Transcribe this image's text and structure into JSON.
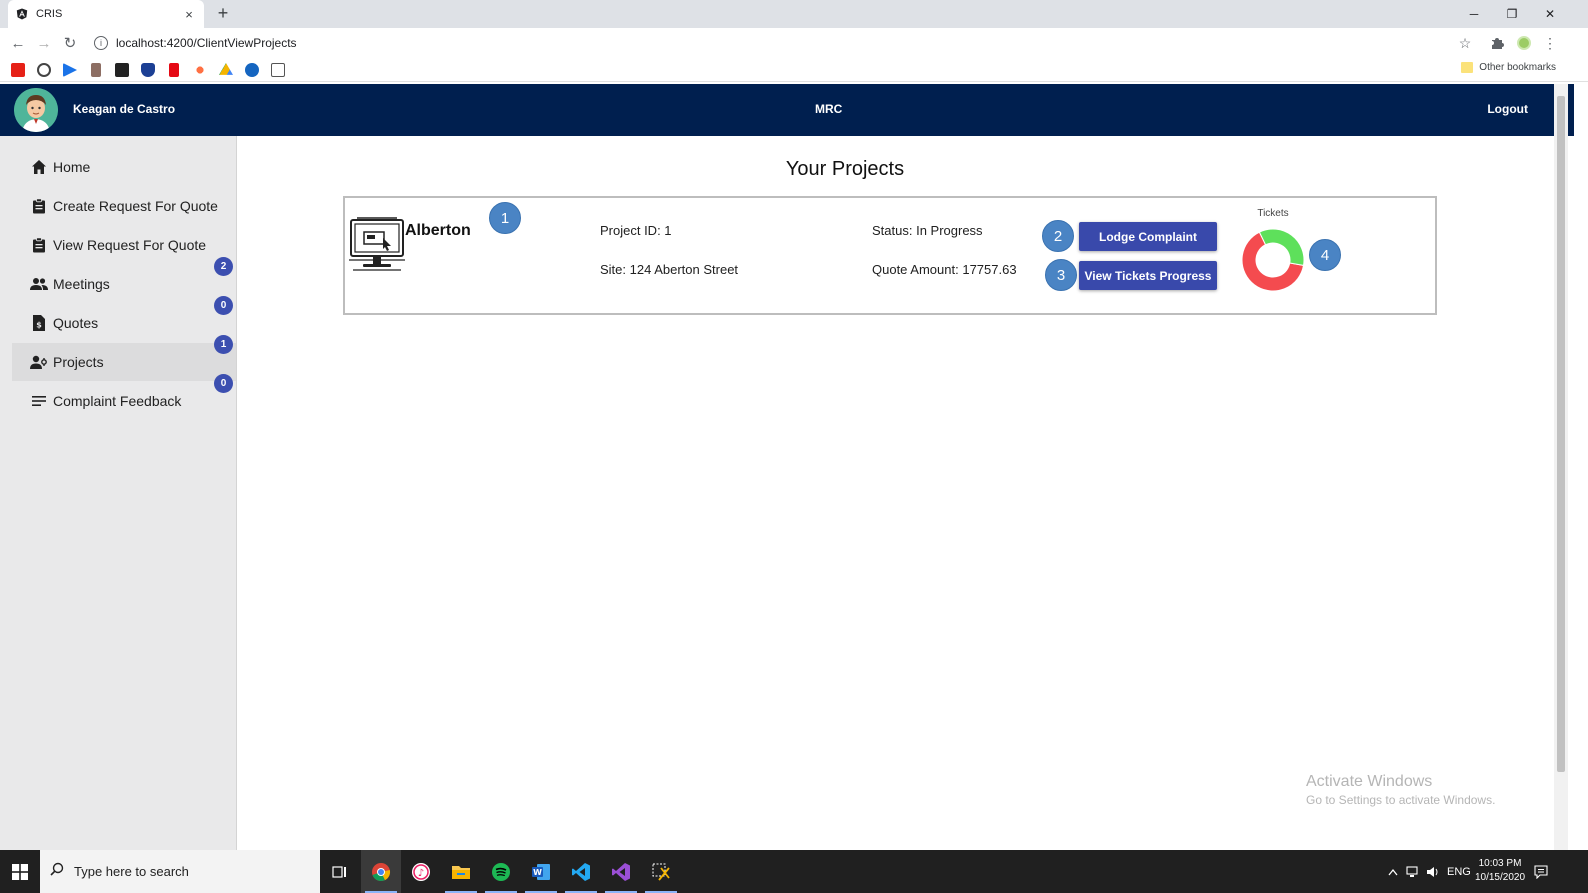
{
  "browser": {
    "tab_title": "CRIS",
    "tab_close": "×",
    "new_tab": "+",
    "url": "localhost:4200/ClientViewProjects",
    "other_bookmarks": "Other bookmarks",
    "window_controls": {
      "minimize": "─",
      "restore": "❐",
      "close": "✕"
    }
  },
  "header": {
    "user_name": "Keagan de Castro",
    "brand": "MRC",
    "logout": "Logout"
  },
  "sidebar": {
    "items": [
      {
        "label": "Home",
        "icon": "home-icon"
      },
      {
        "label": "Create Request For Quote",
        "icon": "clipboard-icon"
      },
      {
        "label": "View Request For Quote",
        "icon": "clipboard-icon"
      },
      {
        "label": "Meetings",
        "icon": "people-icon"
      },
      {
        "label": "Quotes",
        "icon": "invoice-icon"
      },
      {
        "label": "Projects",
        "icon": "person-manage-icon"
      },
      {
        "label": "Complaint Feedback",
        "icon": "list-icon"
      }
    ],
    "badges": [
      "2",
      "0",
      "1",
      "0"
    ]
  },
  "main": {
    "title": "Your Projects",
    "project": {
      "name": "Alberton",
      "project_id": "Project ID: 1",
      "site": "Site: 124 Aberton Street",
      "status": "Status: In Progress",
      "quote_amount": "Quote Amount: 17757.63",
      "lodge_label": "Lodge Complaint",
      "view_tickets_label": "View Tickets Progress",
      "markers": [
        "1",
        "2",
        "3",
        "4"
      ]
    }
  },
  "chart_data": {
    "type": "pie",
    "title": "Tickets",
    "series": [
      {
        "values": [
          65,
          35
        ]
      }
    ],
    "colors": [
      "#f44b4f",
      "#5ee05b"
    ]
  },
  "watermark": {
    "line1": "Activate Windows",
    "line2": "Go to Settings to activate Windows."
  },
  "taskbar": {
    "search_placeholder": "Type here to search",
    "tray_lang": "ENG",
    "time": "10:03 PM",
    "date": "10/15/2020"
  },
  "colors": {
    "header_bg": "#001f4f",
    "button": "#3949ab",
    "badge": "#3c4fb0",
    "marker": "#4a84c4"
  }
}
